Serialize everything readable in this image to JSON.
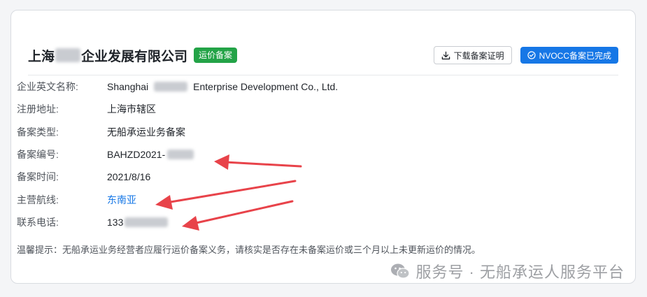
{
  "company": {
    "name_prefix": "上海",
    "name_suffix": "企业发展有限公司",
    "badge": "运价备案"
  },
  "actions": {
    "download_label": "下载备案证明",
    "nvocc_label": "NVOCC备案已完成"
  },
  "fields": [
    {
      "label": "企业英文名称:",
      "value_prefix": "Shanghai",
      "value_suffix": "Enterprise Development Co., Ltd."
    },
    {
      "label": "注册地址:",
      "value": "上海市辖区"
    },
    {
      "label": "备案类型:",
      "value": "无船承运业务备案"
    },
    {
      "label": "备案编号:",
      "value": "BAHZD2021-"
    },
    {
      "label": "备案时间:",
      "value": "2021/8/16"
    },
    {
      "label": "主营航线:",
      "value": "东南亚"
    },
    {
      "label": "联系电话:",
      "value": "133"
    }
  ],
  "tip": "温馨提示：无船承运业务经营者应履行运价备案义务，请核实是否存在未备案运价或三个月以上未更新运价的情况。",
  "watermark": "服务号 · 无船承运人服务平台",
  "colors": {
    "badge": "#23a347",
    "primary": "#1677e6",
    "link": "#1677e6",
    "arrow": "#e8434a"
  }
}
